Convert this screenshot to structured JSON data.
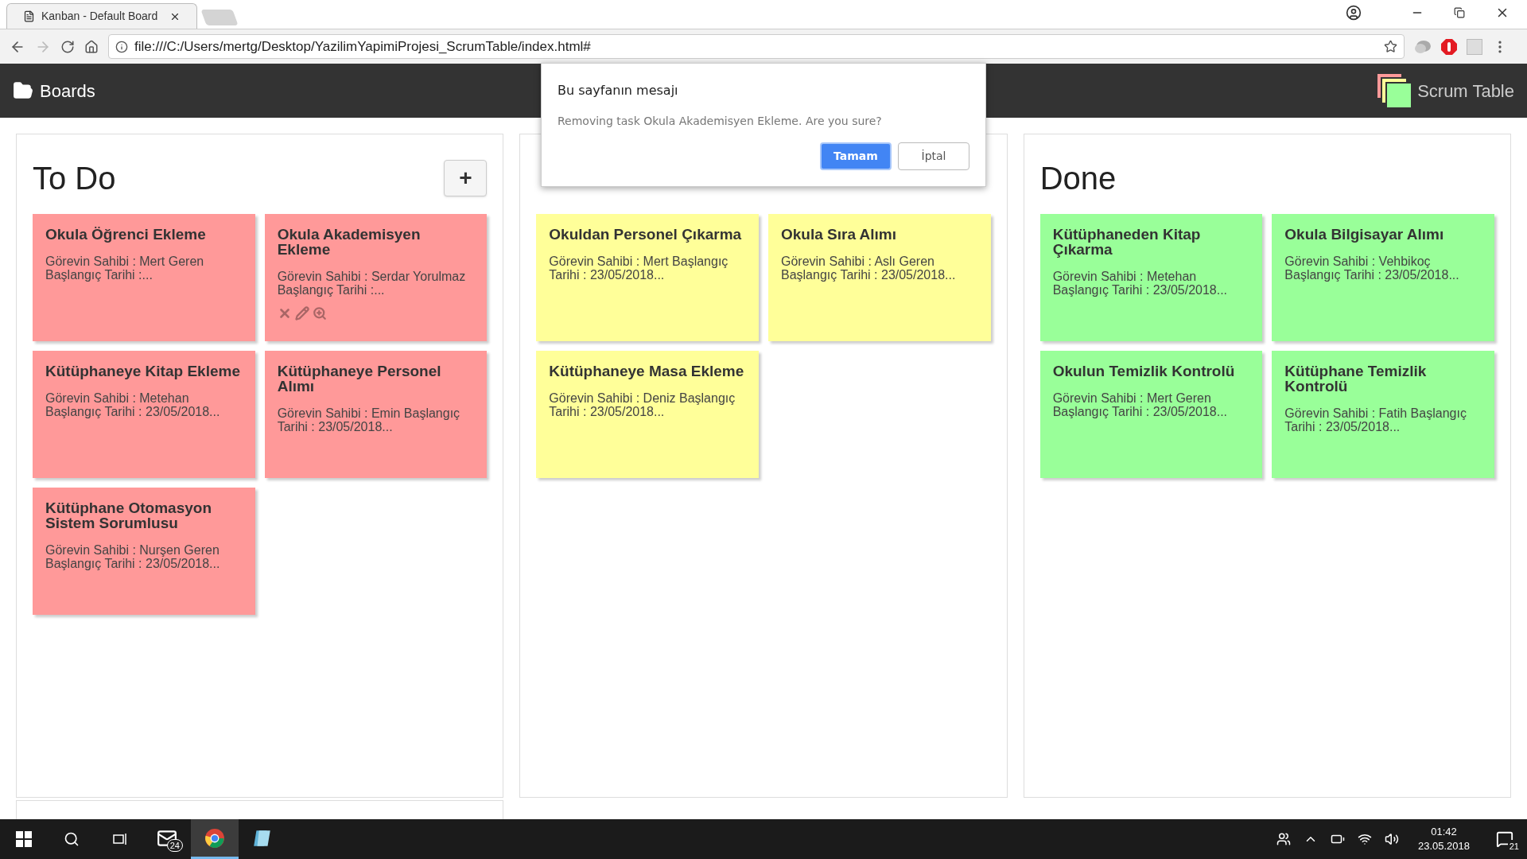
{
  "browser": {
    "tab_title": "Kanban - Default Board",
    "url": "file:///C:/Users/mertg/Desktop/YazilimYapimiProjesi_ScrumTable/index.html#"
  },
  "header": {
    "boards_label": "Boards",
    "app_name": "Scrum Table"
  },
  "columns": [
    {
      "title": "To Do",
      "color": "#ff9999",
      "add_label": "+",
      "cards": [
        {
          "title": "Okula Öğrenci Ekleme",
          "summary": "Görevin Sahibi : Mert Geren Başlangıç Tarihi :...",
          "actions_visible": false
        },
        {
          "title": "Okula Akademisyen Ekleme",
          "summary": "Görevin Sahibi : Serdar Yorulmaz Başlangıç Tarihi :...",
          "actions_visible": true
        },
        {
          "title": "Kütüphaneye Kitap Ekleme",
          "summary": "Görevin Sahibi : Metehan Başlangıç Tarihi : 23/05/2018...",
          "actions_visible": false
        },
        {
          "title": "Kütüphaneye Personel Alımı",
          "summary": "Görevin Sahibi : Emin Başlangıç Tarihi : 23/05/2018...",
          "actions_visible": false
        },
        {
          "title": "Kütüphane Otomasyon Sistem Sorumlusu",
          "summary": "Görevin Sahibi : Nurşen Geren Başlangıç Tarihi : 23/05/2018...",
          "actions_visible": false
        }
      ]
    },
    {
      "color": "#ffff99",
      "cards": [
        {
          "title": "Okuldan Personel Çıkarma",
          "summary": "Görevin Sahibi : Mert Başlangıç Tarihi : 23/05/2018...",
          "actions_visible": false
        },
        {
          "title": "Okula Sıra Alımı",
          "summary": "Görevin Sahibi : Aslı Geren Başlangıç Tarihi : 23/05/2018...",
          "actions_visible": false
        },
        {
          "title": "Kütüphaneye Masa Ekleme",
          "summary": "Görevin Sahibi : Deniz Başlangıç Tarihi : 23/05/2018...",
          "actions_visible": false
        }
      ]
    },
    {
      "title": "Done",
      "color": "#99ff99",
      "cards": [
        {
          "title": "Kütüphaneden Kitap Çıkarma",
          "summary": "Görevin Sahibi : Metehan Başlangıç Tarihi : 23/05/2018...",
          "actions_visible": false
        },
        {
          "title": "Okula Bilgisayar Alımı",
          "summary": "Görevin Sahibi : Vehbikoç Başlangıç Tarihi : 23/05/2018...",
          "actions_visible": false
        },
        {
          "title": "Okulun Temizlik Kontrolü",
          "summary": "Görevin Sahibi : Mert Geren Başlangıç Tarihi : 23/05/2018...",
          "actions_visible": false
        },
        {
          "title": "Kütüphane Temizlik Kontrolü",
          "summary": "Görevin Sahibi : Fatih Başlangıç Tarihi : 23/05/2018...",
          "actions_visible": false
        }
      ]
    }
  ],
  "dialog": {
    "title": "Bu sayfanın mesajı",
    "message": "Removing task Okula Akademisyen Ekleme. Are you sure?",
    "buttons": [
      {
        "label": "Tamam",
        "kind": "primary"
      },
      {
        "label": "İptal",
        "kind": "secondary"
      }
    ]
  },
  "taskbar": {
    "apps": [
      {
        "kind": "mail",
        "badge": "24",
        "selected": false
      },
      {
        "kind": "browser",
        "selected": true
      },
      {
        "kind": "notes",
        "selected": false
      }
    ],
    "time": "01:42",
    "date": "23.05.2018",
    "notifications": "21"
  }
}
